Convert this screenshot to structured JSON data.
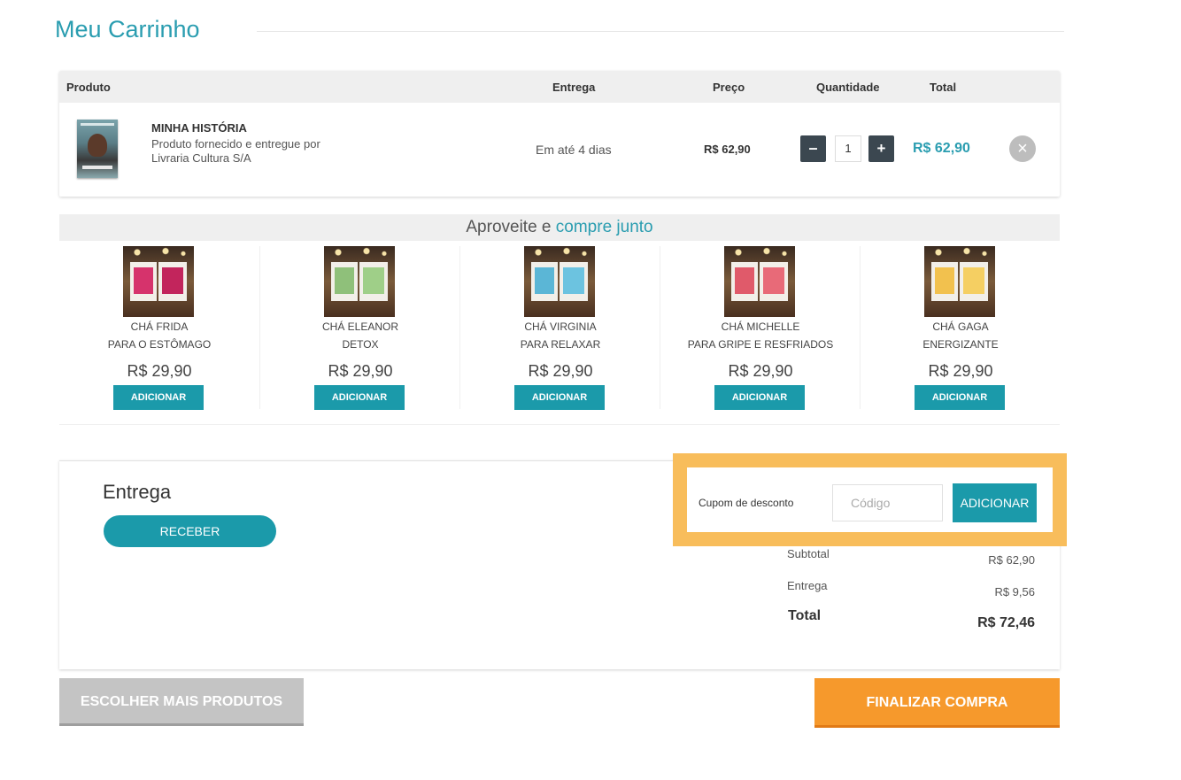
{
  "page": {
    "title": "Meu Carrinho"
  },
  "cart": {
    "headers": {
      "product": "Produto",
      "delivery": "Entrega",
      "price": "Preço",
      "quantity": "Quantidade",
      "total": "Total"
    },
    "item": {
      "name": "MINHA HISTÓRIA",
      "desc_line1": "Produto fornecido e entregue por",
      "desc_line2": "Livraria Cultura S/A",
      "delivery": "Em até 4 dias",
      "price": "R$ 62,90",
      "quantity": "1",
      "total": "R$ 62,90"
    },
    "minus": "–",
    "plus": "+",
    "remove": "×"
  },
  "together": {
    "prefix": "Aproveite e ",
    "highlight": "compre junto",
    "products": [
      {
        "name1": "CHÁ FRIDA",
        "name2": "PARA O ESTÔMAGO",
        "price": "R$ 29,90",
        "button": "ADICIONAR",
        "panel_color": "#d6336c",
        "panel2_color": "#c2255c"
      },
      {
        "name1": "CHÁ ELEANOR",
        "name2": "DETOX",
        "price": "R$ 29,90",
        "button": "ADICIONAR",
        "panel_color": "#8fc07a",
        "panel2_color": "#9fcf88"
      },
      {
        "name1": "CHÁ VIRGINIA",
        "name2": "PARA RELAXAR",
        "price": "R$ 29,90",
        "button": "ADICIONAR",
        "panel_color": "#5bb6d6",
        "panel2_color": "#6cc3e0"
      },
      {
        "name1": "CHÁ MICHELLE",
        "name2": "PARA GRIPE E RESFRIADOS",
        "price": "R$ 29,90",
        "button": "ADICIONAR",
        "panel_color": "#e05a6a",
        "panel2_color": "#e86a78"
      },
      {
        "name1": "CHÁ GAGA",
        "name2": "ENERGIZANTE",
        "price": "R$ 29,90",
        "button": "ADICIONAR",
        "panel_color": "#f2c14e",
        "panel2_color": "#f5cf62"
      }
    ]
  },
  "summary": {
    "delivery_title": "Entrega",
    "receive_button": "RECEBER",
    "subtotal_label": "Subtotal",
    "subtotal_value": "R$ 62,90",
    "delivery_label": "Entrega",
    "delivery_value": "R$ 9,56",
    "total_label": "Total",
    "total_value": "R$ 72,46"
  },
  "coupon": {
    "label": "Cupom de desconto",
    "placeholder": "Código",
    "button": "ADICIONAR",
    "highlight_color": "#f8bd5b"
  },
  "actions": {
    "more_products": "ESCOLHER MAIS PRODUTOS",
    "finish": "FINALIZAR COMPRA"
  },
  "colors": {
    "accent": "#1b9aaa",
    "title": "#2a9db0",
    "finish": "#f6992c",
    "secondary": "#c4c4c4"
  }
}
